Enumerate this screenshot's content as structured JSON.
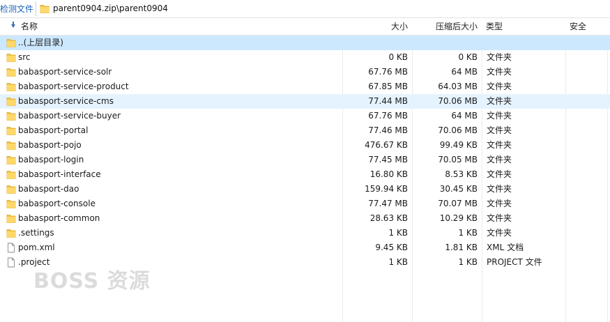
{
  "toolbar": {
    "left_tab_label": "检测文件",
    "path": "parent0904.zip\\parent0904"
  },
  "columns": {
    "name": "名称",
    "size": "大小",
    "compressed": "压缩后大小",
    "type": "类型",
    "security": "安全"
  },
  "rows": [
    {
      "name": "..(上层目录)",
      "size": "",
      "compressed": "",
      "type": "",
      "icon": "folder-icon"
    },
    {
      "name": "src",
      "size": "0 KB",
      "compressed": "0 KB",
      "type": "文件夹",
      "icon": "folder-icon"
    },
    {
      "name": "babasport-service-solr",
      "size": "67.76 MB",
      "compressed": "64 MB",
      "type": "文件夹",
      "icon": "folder-icon"
    },
    {
      "name": "babasport-service-product",
      "size": "67.85 MB",
      "compressed": "64.03 MB",
      "type": "文件夹",
      "icon": "folder-icon"
    },
    {
      "name": "babasport-service-cms",
      "size": "77.44 MB",
      "compressed": "70.06 MB",
      "type": "文件夹",
      "icon": "folder-icon"
    },
    {
      "name": "babasport-service-buyer",
      "size": "67.76 MB",
      "compressed": "64 MB",
      "type": "文件夹",
      "icon": "folder-icon"
    },
    {
      "name": "babasport-portal",
      "size": "77.46 MB",
      "compressed": "70.06 MB",
      "type": "文件夹",
      "icon": "folder-icon"
    },
    {
      "name": "babasport-pojo",
      "size": "476.67 KB",
      "compressed": "99.49 KB",
      "type": "文件夹",
      "icon": "folder-icon"
    },
    {
      "name": "babasport-login",
      "size": "77.45 MB",
      "compressed": "70.05 MB",
      "type": "文件夹",
      "icon": "folder-icon"
    },
    {
      "name": "babasport-interface",
      "size": "16.80 KB",
      "compressed": "8.53 KB",
      "type": "文件夹",
      "icon": "folder-icon"
    },
    {
      "name": "babasport-dao",
      "size": "159.94 KB",
      "compressed": "30.45 KB",
      "type": "文件夹",
      "icon": "folder-icon"
    },
    {
      "name": "babasport-console",
      "size": "77.47 MB",
      "compressed": "70.07 MB",
      "type": "文件夹",
      "icon": "folder-icon"
    },
    {
      "name": "babasport-common",
      "size": "28.63 KB",
      "compressed": "10.29 KB",
      "type": "文件夹",
      "icon": "folder-icon"
    },
    {
      "name": ".settings",
      "size": "1 KB",
      "compressed": "1 KB",
      "type": "文件夹",
      "icon": "folder-icon"
    },
    {
      "name": "pom.xml",
      "size": "9.45 KB",
      "compressed": "1.81 KB",
      "type": "XML 文档",
      "icon": "file-icon"
    },
    {
      "name": ".project",
      "size": "1 KB",
      "compressed": "1 KB",
      "type": "PROJECT 文件",
      "icon": "file-icon"
    }
  ],
  "watermark": "BOSS 资源",
  "colors": {
    "selected_row": "#cce8ff",
    "hover_row": "#e5f3ff",
    "folder": "#f5c542",
    "link": "#1e63b8"
  }
}
